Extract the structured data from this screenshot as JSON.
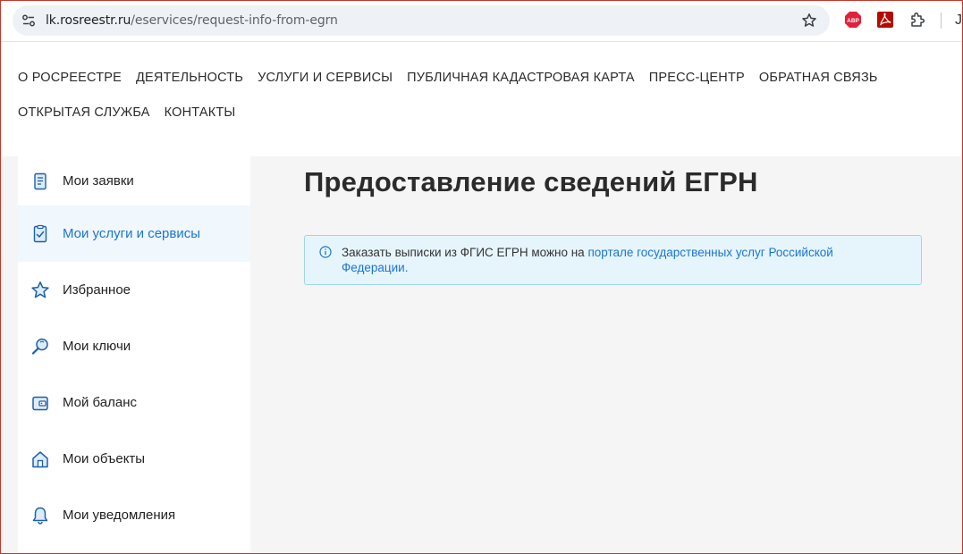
{
  "browser": {
    "url_host": "lk.rosreestr.ru",
    "url_path": "/eservices/request-info-from-egrn",
    "extensions": [
      "adblock-plus-icon",
      "pdf-icon",
      "puzzle-icon"
    ],
    "abp_label": "ABP"
  },
  "nav": {
    "row1": [
      "О РОСРЕЕСТРЕ",
      "ДЕЯТЕЛЬНОСТЬ",
      "УСЛУГИ И СЕРВИСЫ",
      "ПУБЛИЧНАЯ КАДАСТРОВАЯ КАРТА",
      "ПРЕСС-ЦЕНТР",
      "ОБРАТНАЯ СВЯЗЬ"
    ],
    "row2": [
      "ОТКРЫТАЯ СЛУЖБА",
      "КОНТАКТЫ"
    ]
  },
  "sidebar": {
    "items": [
      {
        "label": "Мои заявки",
        "icon": "document-list-icon"
      },
      {
        "label": "Мои услуги и сервисы",
        "icon": "checklist-icon",
        "active": true
      },
      {
        "label": "Избранное",
        "icon": "star-icon"
      },
      {
        "label": "Мои ключи",
        "icon": "key-search-icon"
      },
      {
        "label": "Мой баланс",
        "icon": "wallet-icon"
      },
      {
        "label": "Мои объекты",
        "icon": "house-icon"
      },
      {
        "label": "Мои уведомления",
        "icon": "bell-icon"
      }
    ]
  },
  "main": {
    "title": "Предоставление сведений ЕГРН",
    "alert": {
      "text": "Заказать выписки из ФГИС ЕГРН можно на ",
      "link": "порталe государственных услуг Российской Федерации."
    }
  },
  "colors": {
    "accent": "#1976d2",
    "active_bg": "#f0f7fd",
    "alert_bg": "#e6f5fc",
    "alert_border": "#9fd6ee",
    "content_bg": "#f5f5f5"
  }
}
